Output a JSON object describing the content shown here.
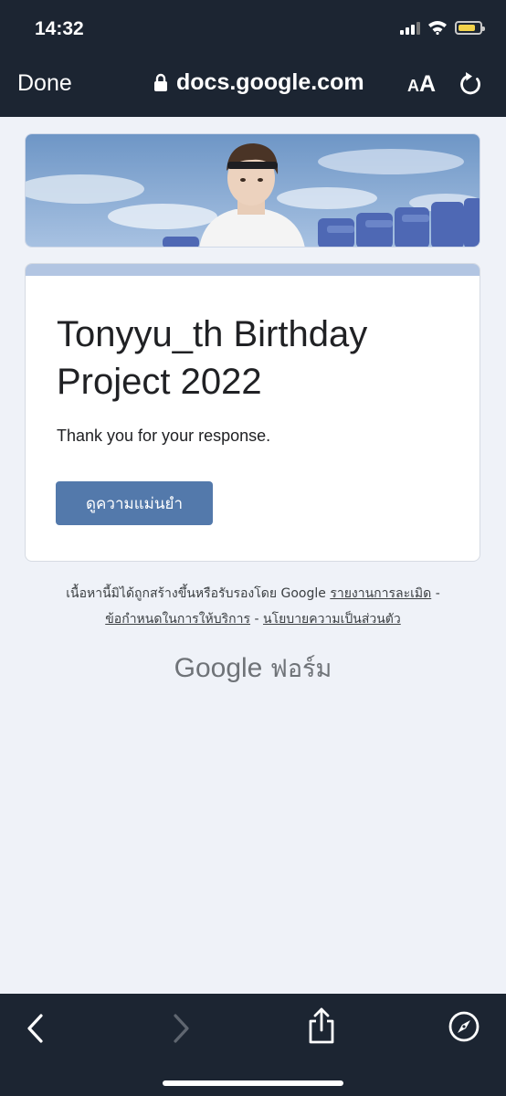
{
  "status_bar": {
    "time": "14:32"
  },
  "nav_bar": {
    "done_label": "Done",
    "url": "docs.google.com",
    "text_size_small": "A",
    "text_size_big": "A"
  },
  "form": {
    "title": "Tonyyu_th Birthday Project 2022",
    "confirmation_message": "Thank you for your response.",
    "view_accuracy_button": "ดูความแม่นยำ",
    "accent_color": "#b2c5e2",
    "button_color": "#5379ab"
  },
  "footer": {
    "disclaimer": "เนื้อหานี้มิได้ถูกสร้างขึ้นหรือรับรองโดย Google",
    "report_abuse": "รายงานการละเมิด",
    "separator": "-",
    "terms": "ข้อกำหนดในการให้บริการ",
    "privacy": "นโยบายความเป็นส่วนตัว"
  },
  "logo": {
    "google": "Google",
    "forms": "ฟอร์ม"
  },
  "toolbar": {
    "icons": [
      "back-icon",
      "forward-icon",
      "share-icon",
      "compass-icon"
    ]
  },
  "colors": {
    "chrome": "#1c2532",
    "page_background": "#eff2f8"
  }
}
